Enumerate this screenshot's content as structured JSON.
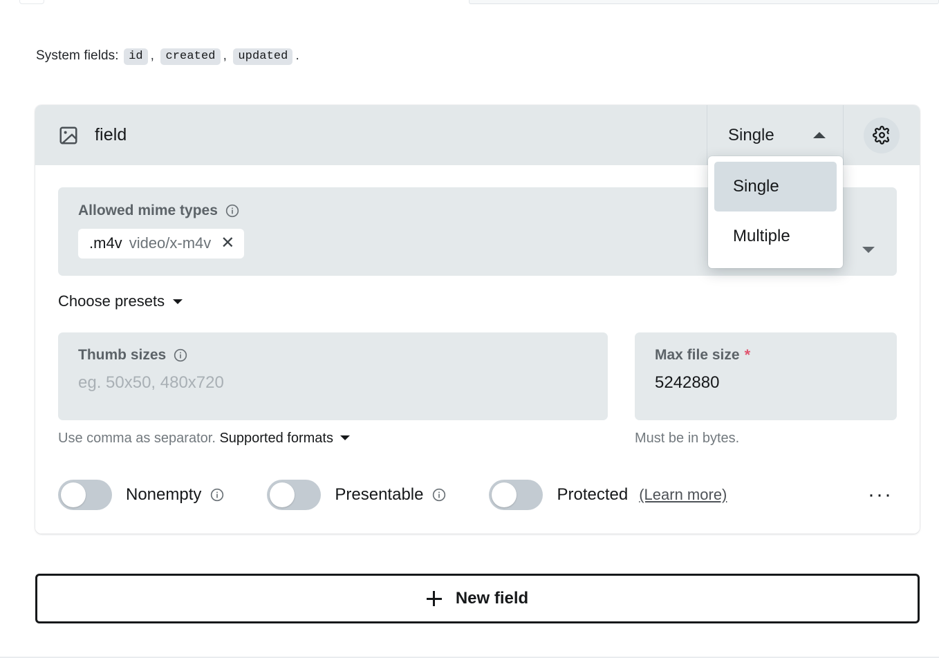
{
  "system_fields": {
    "label": "System fields:",
    "fields": [
      "id",
      "created",
      "updated"
    ],
    "separator": ",",
    "terminator": "."
  },
  "field_card": {
    "icon": "image-icon",
    "name": "field",
    "type_select": {
      "value": "Single",
      "caret": "chevron-up-icon",
      "open": true,
      "options": [
        "Single",
        "Multiple"
      ],
      "selected_option": "Single"
    },
    "settings_button": {
      "icon": "gear-icon"
    },
    "mime_types": {
      "label": "Allowed mime types",
      "info_icon": "info-icon",
      "chips": [
        {
          "ext": ".m4v",
          "mime": "video/x-m4v",
          "remove_icon": "close-icon"
        }
      ]
    },
    "presets": {
      "label": "Choose presets",
      "caret": "chevron-down-icon"
    },
    "thumb_sizes": {
      "label": "Thumb sizes",
      "info_icon": "info-icon",
      "placeholder": "eg. 50x50, 480x720",
      "value": "",
      "helper_plain": "Use comma as separator.",
      "helper_link": "Supported formats",
      "helper_caret": "chevron-down-icon"
    },
    "max_file_size": {
      "label": "Max file size",
      "required_marker": "*",
      "value": "5242880",
      "helper": "Must be in bytes."
    },
    "toggles": [
      {
        "label": "Nonempty",
        "on": false,
        "info_icon": "info-icon"
      },
      {
        "label": "Presentable",
        "on": false,
        "info_icon": "info-icon"
      },
      {
        "label": "Protected",
        "on": false,
        "link": "(Learn more)"
      }
    ],
    "more_button": {
      "label": "···",
      "icon": "ellipsis-icon"
    }
  },
  "new_field_button": {
    "label": "New field",
    "icon": "plus-icon"
  },
  "colors": {
    "card_header": "#e3e8ea",
    "input_bg": "#e4e9eb",
    "accent_required": "#e0556f",
    "text_primary": "#16181a",
    "text_muted": "#72797e",
    "toggle_off": "#c3cbd2",
    "dropdown_selected": "#d5dde2"
  }
}
